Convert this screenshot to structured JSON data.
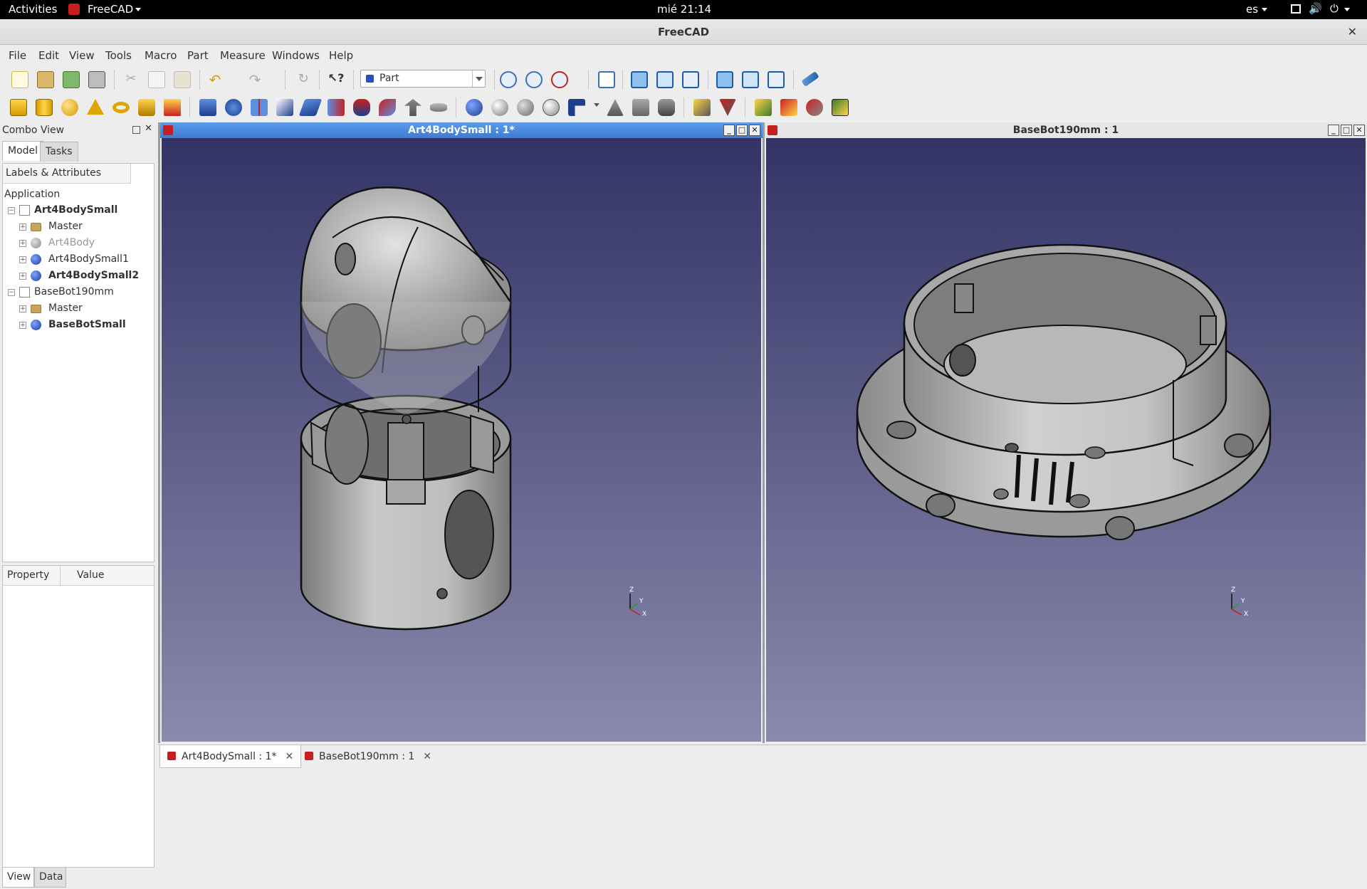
{
  "topbar": {
    "activities": "Activities",
    "app_name": "FreeCAD",
    "clock": "mié 21:14",
    "keyboard": "es"
  },
  "window": {
    "title": "FreeCAD"
  },
  "menu": [
    "File",
    "Edit",
    "View",
    "Tools",
    "Macro",
    "Part",
    "Measure",
    "Windows",
    "Help"
  ],
  "workbench": {
    "selected": "Part"
  },
  "combo": {
    "title": "Combo View",
    "tabs": [
      "Model",
      "Tasks"
    ],
    "tree_header": "Labels & Attributes",
    "tree_root": "Application",
    "tree": [
      {
        "label": "Art4BodySmall",
        "bold": true,
        "level": 0,
        "icon": "document-icon"
      },
      {
        "label": "Master",
        "bold": false,
        "level": 1,
        "icon": "folder-icon"
      },
      {
        "label": "Art4Body",
        "bold": false,
        "level": 1,
        "icon": "hidden-part-icon",
        "dim": true
      },
      {
        "label": "Art4BodySmall1",
        "bold": false,
        "level": 1,
        "icon": "part-icon"
      },
      {
        "label": "Art4BodySmall2",
        "bold": true,
        "level": 1,
        "icon": "part-icon"
      },
      {
        "label": "BaseBot190mm",
        "bold": false,
        "level": 0,
        "icon": "document-icon"
      },
      {
        "label": "Master",
        "bold": false,
        "level": 1,
        "icon": "folder-icon"
      },
      {
        "label": "BaseBotSmall",
        "bold": true,
        "level": 1,
        "icon": "part-icon"
      }
    ],
    "property_headers": [
      "Property",
      "Value"
    ],
    "bottom_tabs": [
      "View",
      "Data"
    ]
  },
  "views": [
    {
      "title": "Art4BodySmall : 1*",
      "active": true
    },
    {
      "title": "BaseBot190mm : 1",
      "active": false
    }
  ],
  "axis_labels": {
    "x": "X",
    "y": "Y",
    "z": "Z"
  },
  "doc_tabs": [
    {
      "label": "Art4BodySmall : 1*",
      "active": true
    },
    {
      "label": "BaseBot190mm : 1",
      "active": false
    }
  ],
  "colors": {
    "active_title": "#4a8ce0",
    "view_top": "#333366",
    "view_bottom": "#8a8aad",
    "part_grey": "#bcbcbc"
  }
}
